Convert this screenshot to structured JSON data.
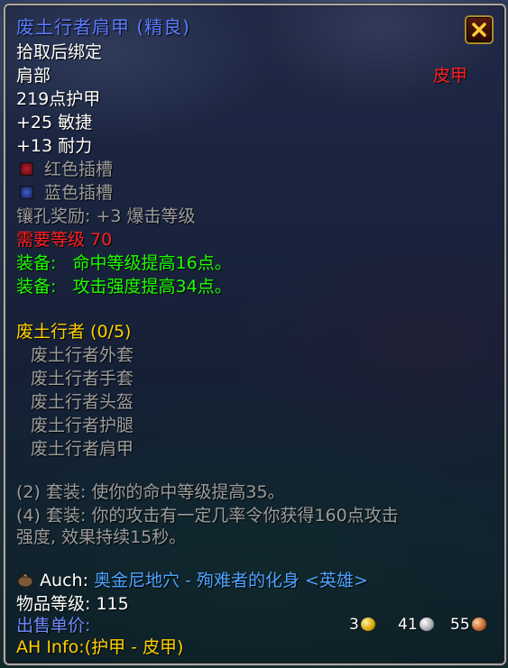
{
  "item": {
    "name": "废土行者肩甲 (精良)",
    "bind": "拾取后绑定",
    "slot": "肩部",
    "armor_type": "皮甲",
    "armor": "219点护甲",
    "stats": [
      "+25 敏捷",
      "+13 耐力"
    ],
    "sockets": [
      "红色插槽",
      "蓝色插槽"
    ],
    "socket_bonus": "镶孔奖励: +3 爆击等级",
    "requirement": "需要等级 70",
    "equip": [
      {
        "label": "装备:",
        "text": "命中等级提高16点。"
      },
      {
        "label": "装备:",
        "text": "攻击强度提高34点。"
      }
    ]
  },
  "set": {
    "header": "废土行者 (0/5)",
    "pieces": [
      "废土行者外套",
      "废土行者手套",
      "废土行者头盔",
      "废土行者护腿",
      "废土行者肩甲"
    ],
    "bonuses": [
      "(2) 套装: 使你的命中等级提高35。",
      "(4) 套装: 你的攻击有一定几率令你获得160点攻击",
      "强度, 效果持续15秒。"
    ]
  },
  "source": {
    "label": "Auch:",
    "text": "奥金尼地穴 - 殉难者的化身 <英雄>"
  },
  "item_level": "物品等级: 115",
  "sell": {
    "label": "出售单价:",
    "gold": "3",
    "silver": "41",
    "copper": "55"
  },
  "ah_info": "AH Info:(护甲 - 皮甲)",
  "colors": {
    "title": "#5b7cff",
    "green": "#1eff00",
    "red": "#ff2020",
    "gold": "#ffd100"
  }
}
